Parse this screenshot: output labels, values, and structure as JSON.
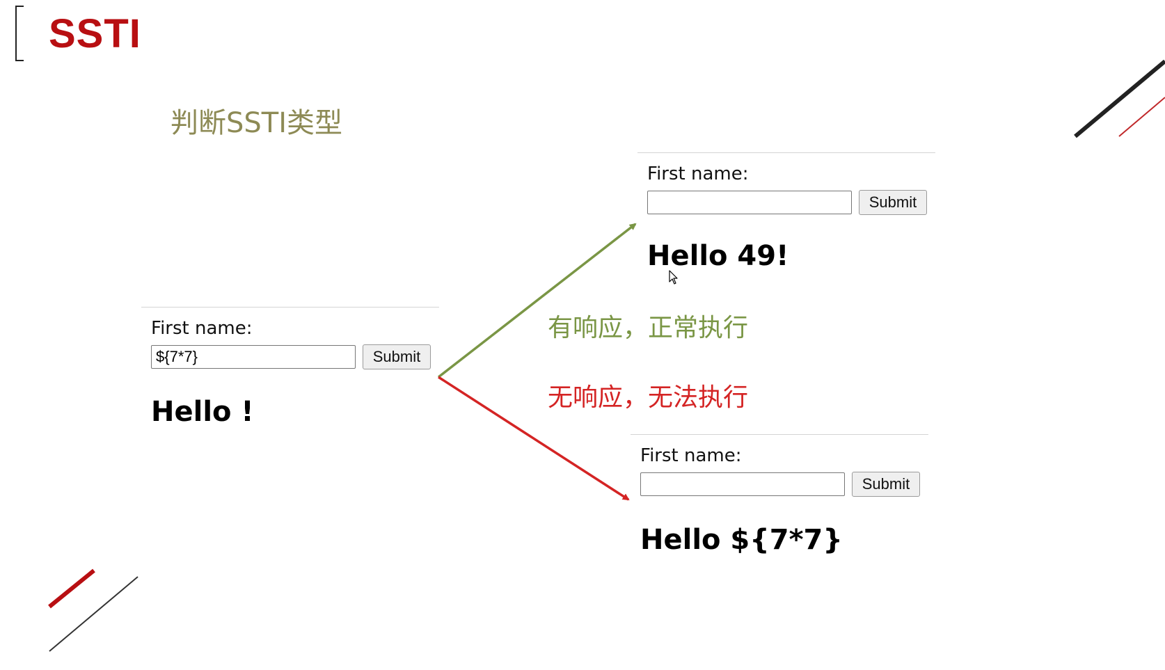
{
  "slide": {
    "title": "SSTI",
    "subtitle": "判断SSTI类型"
  },
  "colors": {
    "title": "#b80f12",
    "subtitle": "#8d8a55",
    "success_arrow": "#7a9645",
    "fail_arrow": "#d42424"
  },
  "input_panel": {
    "label": "First name:",
    "field_value": "${7*7}",
    "button_label": "Submit",
    "result": "Hello !"
  },
  "success_panel": {
    "label": "First name:",
    "field_value": "",
    "button_label": "Submit",
    "result": "Hello 49!"
  },
  "fail_panel": {
    "label": "First name:",
    "field_value": "",
    "button_label": "Submit",
    "result": "Hello ${7*7}"
  },
  "notes": {
    "success": "有响应，正常执行",
    "fail": "无响应，无法执行"
  },
  "icons": {
    "cursor": "mouse-pointer-icon"
  }
}
